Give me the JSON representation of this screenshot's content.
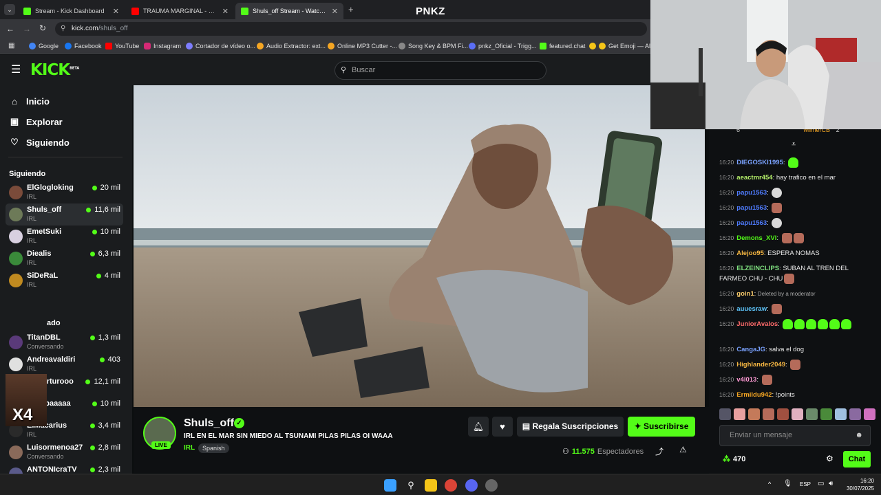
{
  "browser": {
    "tabs": [
      {
        "label": "Stream - Kick Dashboard",
        "color": "#53fc18"
      },
      {
        "label": "TRAUMA MARGINAL - PNKZ 🏠",
        "color": "#ff0000"
      },
      {
        "label": "Shuls_off Stream - Watch Li",
        "color": "#53fc18",
        "active": true
      }
    ],
    "url_host": "kick.com",
    "url_path": "/shuls_off",
    "bookmarks": [
      "Google",
      "Facebook",
      "YouTube",
      "Instagram",
      "Cortador de vídeo o...",
      "Audio Extractor: ext...",
      "Online MP3 Cutter -...",
      "Song Key & BPM Fi...",
      "pnkz_Oficial - Trigg...",
      "featured.chat",
      "Get Emoji — All..."
    ]
  },
  "overlay": {
    "brand": "PNKZ"
  },
  "kick": {
    "logo": "KICK",
    "logo_beta": "BETA",
    "search_placeholder": "Buscar",
    "nav": [
      "Inicio",
      "Explorar",
      "Siguiendo"
    ],
    "following_heading": "Siguiendo",
    "channels": [
      {
        "name": "ElGlogloking",
        "category": "IRL",
        "viewers": "20 mil",
        "color": "#7a4b3a"
      },
      {
        "name": "Shuls_off",
        "category": "IRL",
        "viewers": "11,6 mil",
        "color": "#6d7a58",
        "selected": true
      },
      {
        "name": "EmetSuki",
        "category": "IRL",
        "viewers": "10 mil",
        "color": "#d8d0e0"
      },
      {
        "name": "Diealis",
        "category": "IRL",
        "viewers": "6,3 mil",
        "color": "#3a8a3a"
      },
      {
        "name": "SiDeRaL",
        "category": "IRL",
        "viewers": "4 mil",
        "color": "#c08a20"
      },
      {
        "name": "TitanDBL",
        "category": "Conversando",
        "viewers": "1,3 mil",
        "color": "#5a3a7a"
      },
      {
        "name": "Andreavaldiri",
        "category": "IRL",
        "viewers": "403",
        "color": "#e0e0e0"
      },
      {
        "name": "aldoarturooo",
        "category": "IRL",
        "viewers": "12,1 mil",
        "color": "#7a7a4a"
      },
      {
        "name": "LaSapaaaaa",
        "category": "IRL",
        "viewers": "10 mil",
        "color": "#6a4a3a"
      },
      {
        "name": "ElMacarius",
        "category": "IRL",
        "viewers": "3,4 mil",
        "color": "#2a2a2a"
      },
      {
        "name": "Luisormenoa27",
        "category": "Conversando",
        "viewers": "2,8 mil",
        "color": "#8a6a5a"
      },
      {
        "name": "ANTONIcraTV",
        "category": "",
        "viewers": "2,3 mil",
        "color": "#5a5a8a"
      }
    ],
    "partial_label": "ado",
    "x4_label": "X4"
  },
  "stream": {
    "streamer": "Shuls_off",
    "live": "LIVE",
    "title": "IRL EN EL MAR SIN MIEDO AL TSUNAMI PILAS PILAS OI WAAA",
    "category": "IRL",
    "language": "Spanish",
    "gift_label": "Regala Suscripciones",
    "subscribe_label": "Suscribirse",
    "viewers": "11.575",
    "viewers_label": "Espectadores"
  },
  "chat": {
    "top_partial": [
      {
        "value": "6"
      },
      {
        "name": "wilmerCB",
        "value": "2"
      }
    ],
    "messages": [
      {
        "time": "16:20",
        "user": "DIEGOSKI1995",
        "color": "#7aa2ff",
        "text": "",
        "emotes": [
          "g"
        ]
      },
      {
        "time": "16:20",
        "user": "aeactmr454",
        "color": "#b5f06a",
        "text": "hay trafico en el mar",
        "emotes": []
      },
      {
        "time": "16:20",
        "user": "papu1563",
        "color": "#4f7cff",
        "text": "",
        "emotes": [
          "w"
        ]
      },
      {
        "time": "16:20",
        "user": "papu1563",
        "color": "#4f7cff",
        "text": "",
        "emotes": [
          "f"
        ]
      },
      {
        "time": "16:20",
        "user": "papu1563",
        "color": "#4f7cff",
        "text": "",
        "emotes": [
          "w"
        ]
      },
      {
        "time": "16:20",
        "user": "Demons_XVI",
        "color": "#53fc18",
        "text": "",
        "emotes": [
          "f",
          "f"
        ]
      },
      {
        "time": "16:20",
        "user": "Alejoo95",
        "color": "#f5b642",
        "text": "ESPERA NOMAS",
        "emotes": []
      },
      {
        "time": "16:20",
        "user": "ELZEINCLIPS",
        "color": "#7fe07f",
        "text": "SUBAN AL TREN DEL FARMEO CHU - CHU",
        "emotes": [
          "f"
        ]
      },
      {
        "time": "16:20",
        "user": "goin1",
        "color": "#f5c86a",
        "text": "Deleted by a moderator",
        "deleted": true,
        "emotes": []
      },
      {
        "time": "16:20",
        "user": "auuesraw",
        "color": "#5fc8ff",
        "text": "",
        "emotes": [
          "f"
        ]
      },
      {
        "time": "16:20",
        "user": "JuniorAvalos",
        "color": "#ff6b6b",
        "text": "",
        "emotes": [
          "g",
          "g",
          "g",
          "g",
          "g",
          "g"
        ]
      },
      {
        "time": "16:20",
        "user": "CangaJG",
        "color": "#7aa2ff",
        "text": "salva el dog",
        "emotes": []
      },
      {
        "time": "16:20",
        "user": "Highlander2049",
        "color": "#f5b642",
        "text": "",
        "emotes": [
          "f"
        ]
      },
      {
        "time": "16:20",
        "user": "v4l013",
        "color": "#ff9ad5",
        "text": "",
        "emotes": [
          "f"
        ]
      },
      {
        "time": "16:20",
        "user": "Ermildu942",
        "color": "#f5a623",
        "text": "!points",
        "emotes": []
      }
    ],
    "input_placeholder": "Enviar un mensaje",
    "points": "470",
    "chat_button": "Chat"
  },
  "taskbar": {
    "lang": "ESP",
    "time": "16:20",
    "date": "30/07/2025"
  }
}
